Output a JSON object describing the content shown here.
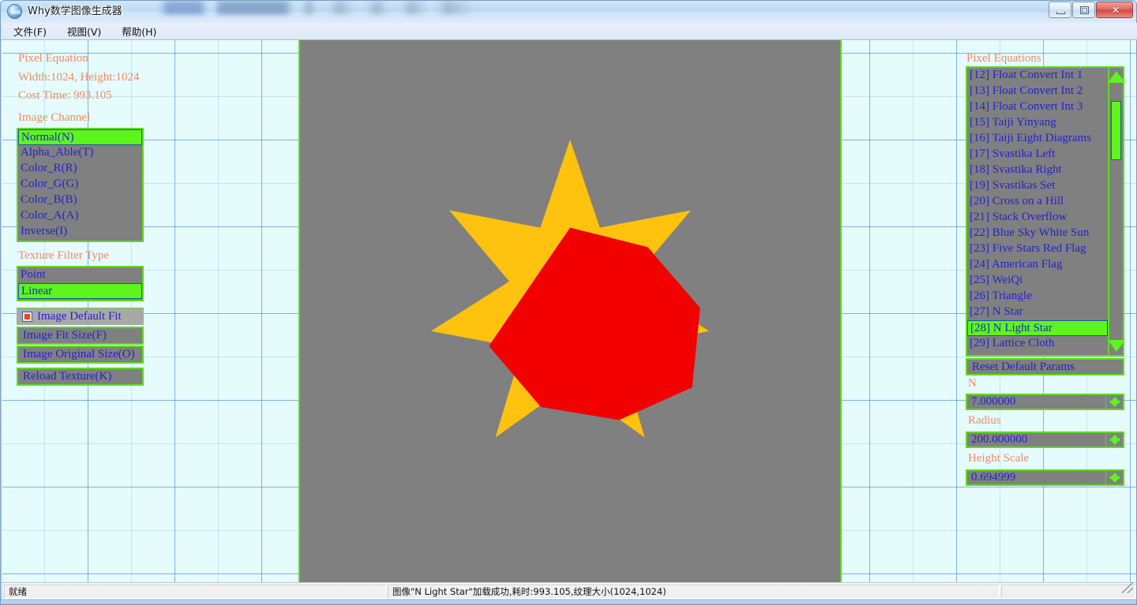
{
  "window": {
    "title": "Why数学图像生成器",
    "icon": "app-globe-icon",
    "minimize_label": "Minimize",
    "maximize_label": "Maximize",
    "close_label": "✕"
  },
  "menubar": {
    "items": [
      {
        "label": "文件(F)"
      },
      {
        "label": "视图(V)"
      },
      {
        "label": "帮助(H)"
      }
    ]
  },
  "left_panel": {
    "info": {
      "heading": "Pixel Equation",
      "size_line": "Width:1024, Height:1024",
      "cost_line": "Cost Time: 993.105"
    },
    "image_channel": {
      "label": "Image Channel",
      "items": [
        {
          "label": "Normal(N)",
          "selected": true
        },
        {
          "label": "Alpha_Able(T)",
          "selected": false
        },
        {
          "label": "Color_R(R)",
          "selected": false
        },
        {
          "label": "Color_G(G)",
          "selected": false
        },
        {
          "label": "Color_B(B)",
          "selected": false
        },
        {
          "label": "Color_A(A)",
          "selected": false
        },
        {
          "label": "Inverse(I)",
          "selected": false
        }
      ]
    },
    "texture_filter": {
      "label": "Texture Filter Type",
      "items": [
        {
          "label": "Point",
          "selected": false
        },
        {
          "label": "Linear",
          "selected": true
        }
      ]
    },
    "fit_checkbox": {
      "label": "Image Default Fit",
      "checked": true
    },
    "buttons": [
      {
        "label": "Image Fit Size(F)"
      },
      {
        "label": "Image Original Size(O)"
      },
      {
        "label": "Reload Texture(K)"
      }
    ]
  },
  "right_panel": {
    "heading": "Pixel Equations",
    "equations": [
      {
        "label": "[12] Float Convert Int 1",
        "selected": false
      },
      {
        "label": "[13] Float Convert Int 2",
        "selected": false
      },
      {
        "label": "[14] Float Convert Int 3",
        "selected": false
      },
      {
        "label": "[15] Taiji Yinyang",
        "selected": false
      },
      {
        "label": "[16] Taiji Eight Diagrams",
        "selected": false
      },
      {
        "label": "[17] Svastika Left",
        "selected": false
      },
      {
        "label": "[18] Svastika Right",
        "selected": false
      },
      {
        "label": "[19] Svastikas Set",
        "selected": false
      },
      {
        "label": "[20] Cross on a Hill",
        "selected": false
      },
      {
        "label": "[21] Stack Overflow",
        "selected": false
      },
      {
        "label": "[22] Blue Sky White Sun",
        "selected": false
      },
      {
        "label": "[23] Five Stars Red Flag",
        "selected": false
      },
      {
        "label": "[24] American Flag",
        "selected": false
      },
      {
        "label": "[25] WeiQi",
        "selected": false
      },
      {
        "label": "[26] Triangle",
        "selected": false
      },
      {
        "label": "[27] N Star",
        "selected": false
      },
      {
        "label": "[28] N Light Star",
        "selected": true
      },
      {
        "label": "[29] Lattice Cloth",
        "selected": false
      }
    ],
    "reset_button": {
      "label": "Reset Default Params"
    },
    "params": [
      {
        "name": "N",
        "value": "7.000000"
      },
      {
        "name": "Radius",
        "value": "200.000000"
      },
      {
        "name": "Height Scale",
        "value": "0.694999"
      }
    ]
  },
  "canvas": {
    "background_color": "#808080",
    "star": {
      "points": 7,
      "point_color": "#FFC20E",
      "core_color": "#F20000",
      "radius": 200,
      "height_scale": 0.694999
    }
  },
  "statusbar": {
    "ready_text": "就绪",
    "message": "图像\"N Light Star\"加载成功,耗时:993.105,纹理大小(1024,1024)",
    "third_cell": ""
  }
}
